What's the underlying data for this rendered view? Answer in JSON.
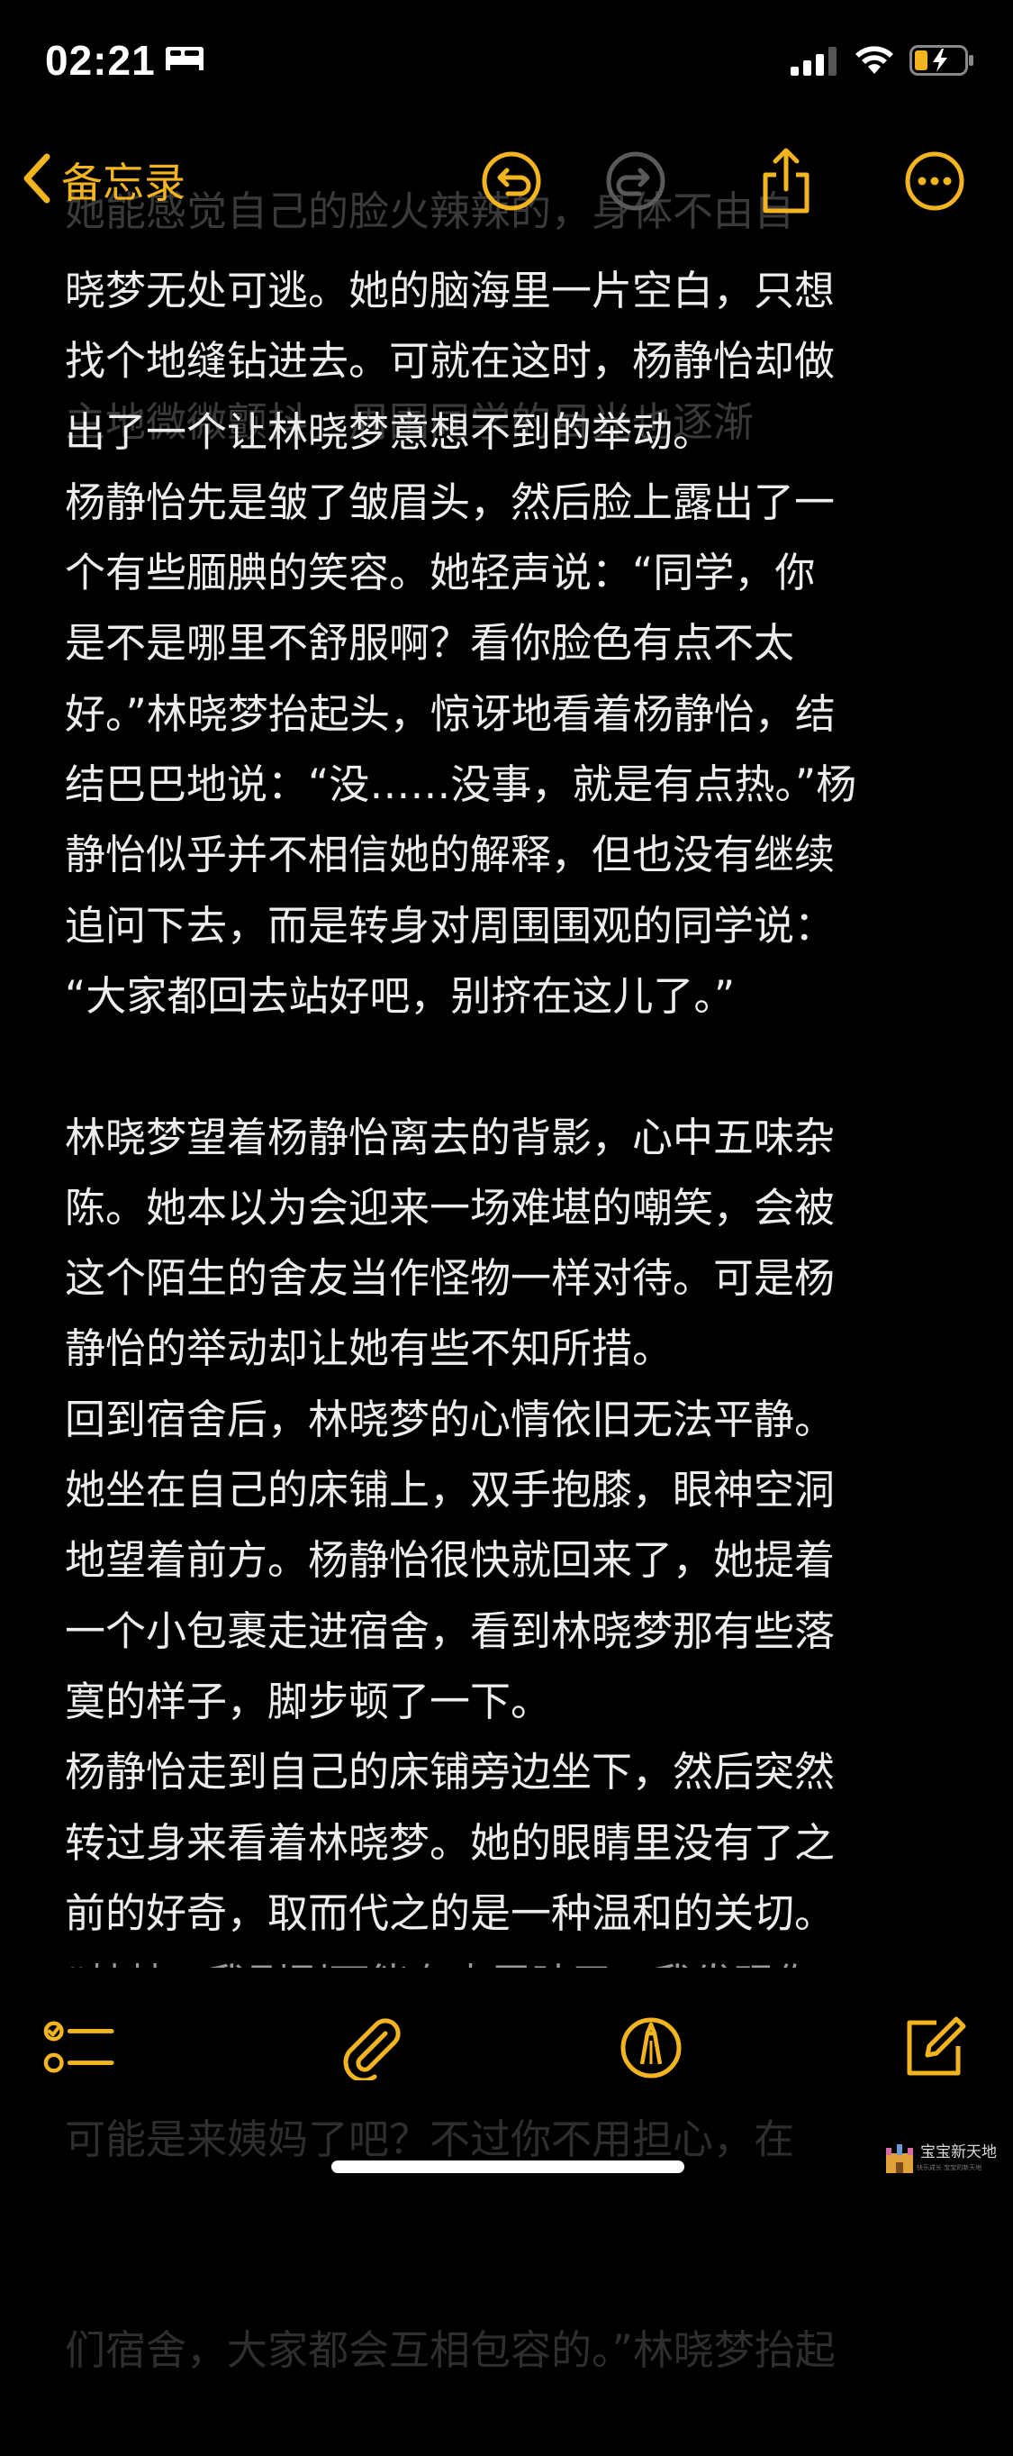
{
  "status_bar": {
    "time": "02:21",
    "icons": [
      "bed-icon",
      "signal-icon",
      "wifi-icon",
      "battery-charging-icon"
    ]
  },
  "nav": {
    "back_label": "备忘录",
    "icons": [
      "undo-icon",
      "redo-icon",
      "share-icon",
      "more-icon"
    ],
    "accent_color": "#F2B51F",
    "disabled_color": "#5a5a5a"
  },
  "note": {
    "faded_top_lines": [
      "她能感觉自己的脸火辣辣的，身体不由自",
      "主地微微颤抖。周围同学的目光也逐渐"
    ],
    "lines": [
      "晓梦无处可逃。她的脑海里一片空白，只想",
      "找个地缝钻进去。可就在这时，杨静怡却做",
      "出了一个让林晓梦意想不到的举动。",
      "杨静怡先是皱了皱眉头，然后脸上露出了一",
      "个有些腼腆的笑容。她轻声说：“同学，你",
      "是不是哪里不舒服啊？看你脸色有点不太",
      "好。”林晓梦抬起头，惊讶地看着杨静怡，结",
      "结巴巴地说：“没……没事，就是有点热。”杨",
      "静怡似乎并不相信她的解释，但也没有继续",
      "追问下去，而是转身对周围围观的同学说：",
      "“大家都回去站好吧，别挤在这儿了。”",
      "",
      "林晓梦望着杨静怡离去的背影，心中五味杂",
      "陈。她本以为会迎来一场难堪的嘲笑，会被",
      "这个陌生的舍友当作怪物一样对待。可是杨",
      "静怡的举动却让她有些不知所措。",
      "回到宿舍后，林晓梦的心情依旧无法平静。",
      "她坐在自己的床铺上，双手抱膝，眼神空洞",
      "地望着前方。杨静怡很快就回来了，她提着",
      "一个小包裹走进宿舍，看到林晓梦那有些落",
      "寞的样子，脚步顿了一下。",
      "杨静怡走到自己的床铺旁边坐下，然后突然",
      "转过身来看着林晓梦。她的眼睛里没有了之",
      "前的好奇，取而代之的是一种温和的关切。",
      "“梦梦，我刚刚可能有点冒昧了。我发现你"
    ],
    "faded_bottom_lines": [
      "可能是来姨妈了吧？不过你不用担心，在",
      "们宿舍，大家都会互相包容的。”林晓梦抬起"
    ],
    "text_color": "#EDEDED"
  },
  "toolbar": {
    "icons": [
      "checklist-icon",
      "paperclip-icon",
      "markup-pen-icon",
      "compose-icon"
    ]
  },
  "watermark": {
    "text": "宝宝新天地",
    "sub": "快乐成长 宝宝的新天地"
  }
}
